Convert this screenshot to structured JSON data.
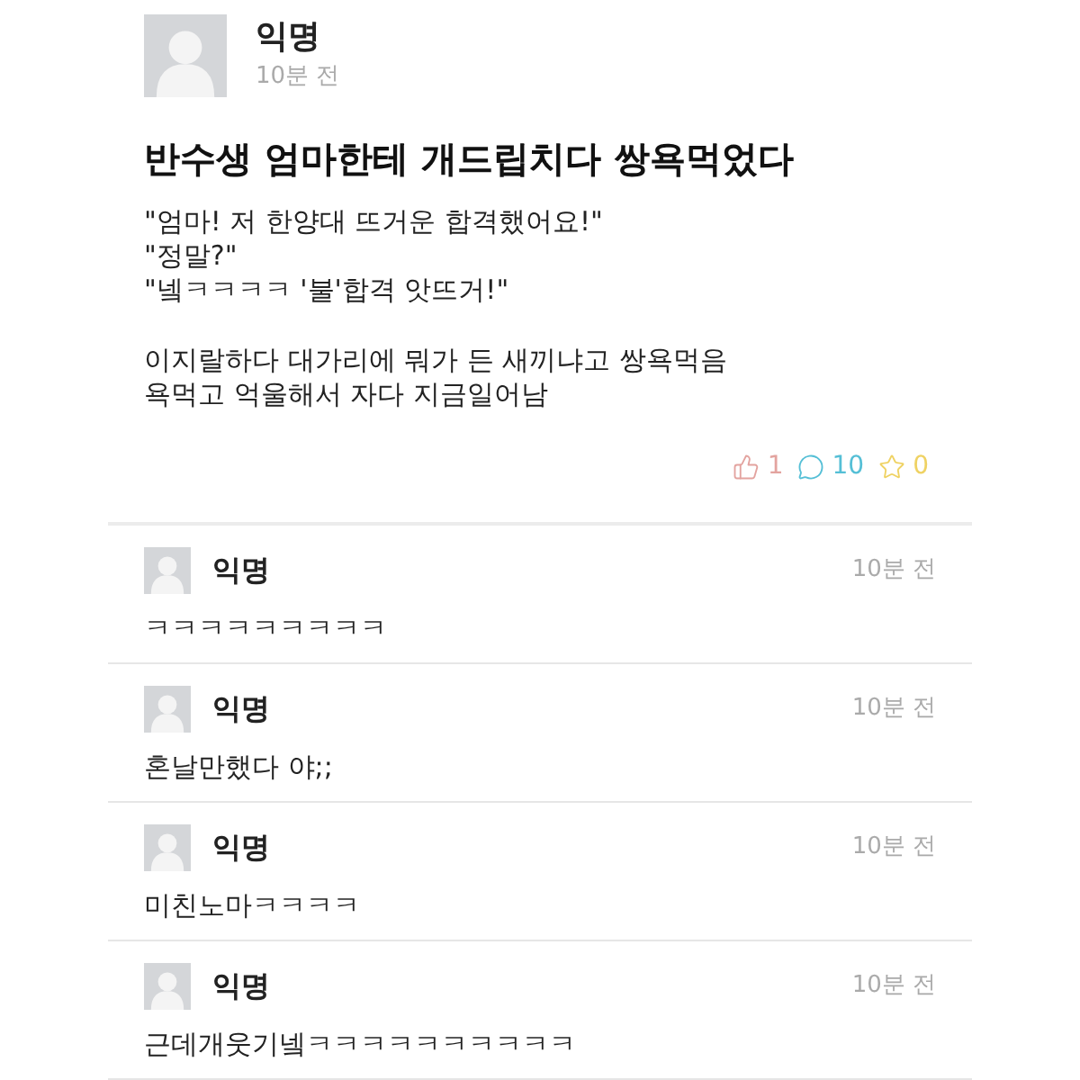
{
  "post": {
    "author": "익명",
    "time": "10분 전",
    "title": "반수생 엄마한테 개드립치다 쌍욕먹었다",
    "paragraphs": [
      [
        "\"엄마! 저 한양대 뜨거운 합격했어요!\"",
        "\"정말?\"",
        "\"넼ㅋㅋㅋㅋ '불'합격 앗뜨거!\""
      ],
      [
        "이지랄하다 대가리에 뭐가 든 새끼냐고 쌍욕먹음",
        "욕먹고 억울해서 자다 지금일어남"
      ]
    ],
    "counters": [
      {
        "kind": "like",
        "count": "1",
        "color": "#e3a39f"
      },
      {
        "kind": "comment",
        "count": "10",
        "color": "#55bfd6"
      },
      {
        "kind": "scrap",
        "count": "0",
        "color": "#efd263"
      }
    ]
  },
  "comments": [
    {
      "author": "익명",
      "time": "10분 전",
      "text": "ㅋㅋㅋㅋㅋㅋㅋㅋㅋ"
    },
    {
      "author": "익명",
      "time": "10분 전",
      "text": "혼날만했다 야;;"
    },
    {
      "author": "익명",
      "time": "10분 전",
      "text": "미친노마ㅋㅋㅋㅋ"
    },
    {
      "author": "익명",
      "time": "10분 전",
      "text": "근데개웃기넼ㅋㅋㅋㅋㅋㅋㅋㅋㅋㅋ"
    }
  ]
}
